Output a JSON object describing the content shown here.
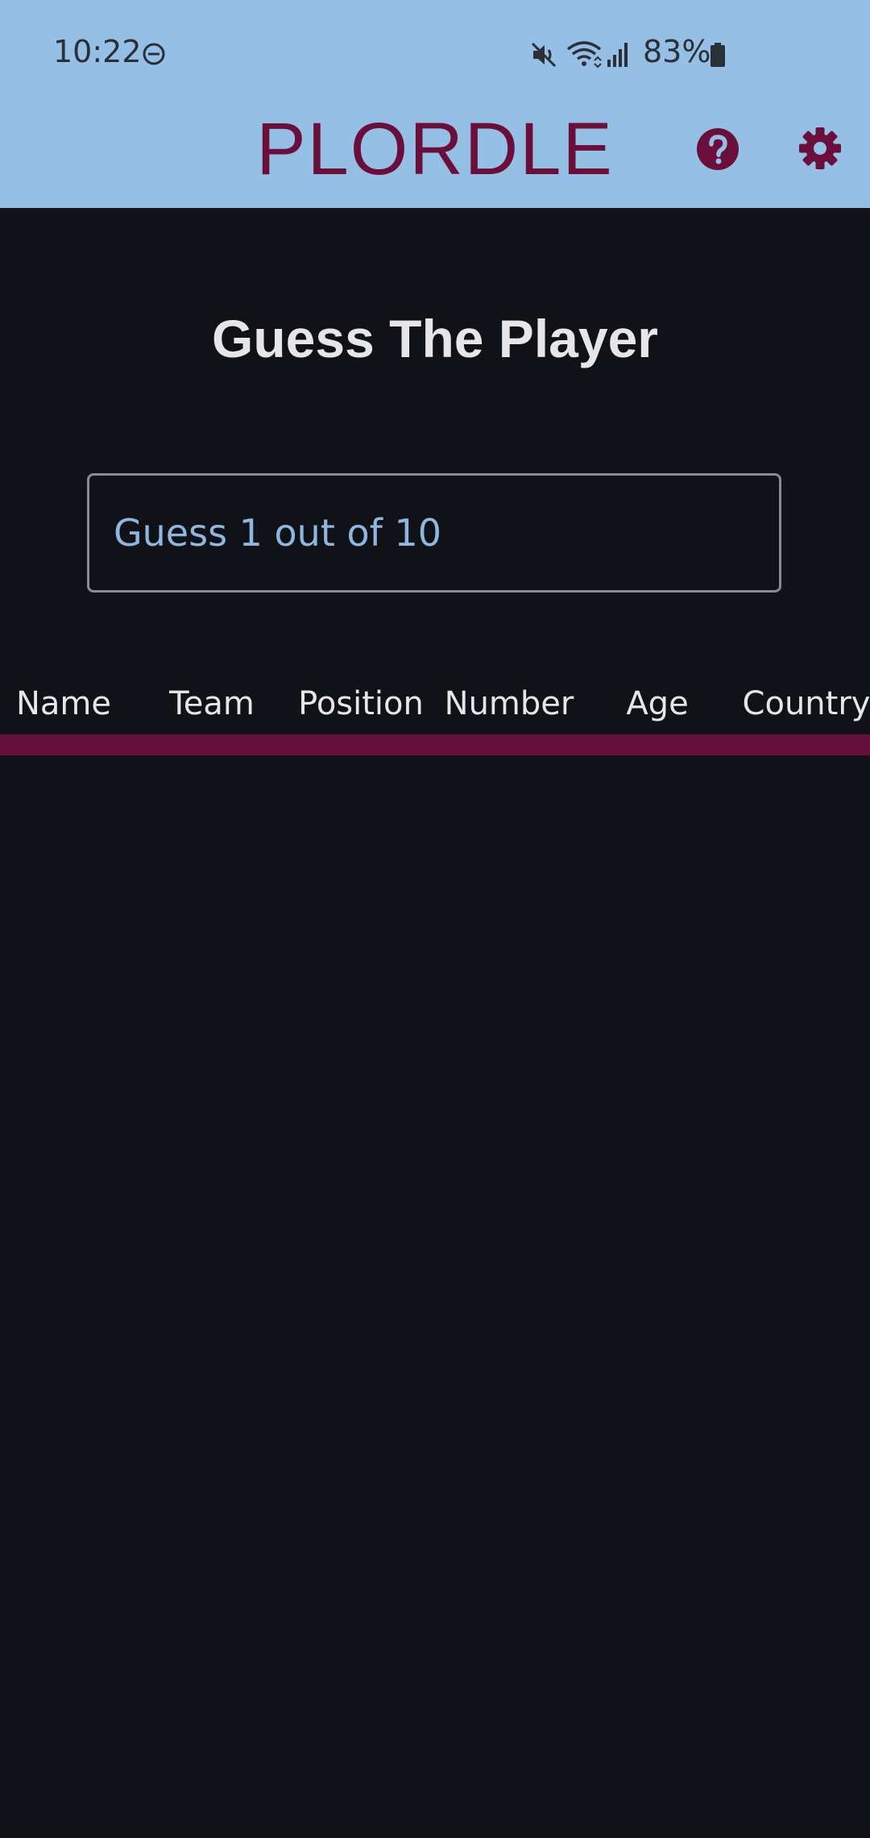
{
  "status_bar": {
    "time": "10:22",
    "battery": "83%"
  },
  "header": {
    "title": "PLORDLE"
  },
  "main": {
    "heading": "Guess The Player",
    "guess_input": {
      "placeholder": "Guess 1 out of 10",
      "value": ""
    },
    "table": {
      "columns": [
        "Name",
        "Team",
        "Position",
        "Number",
        "Age",
        "Country"
      ]
    }
  },
  "colors": {
    "header_bg": "#96bfe5",
    "brand": "#6a0f3c",
    "background": "#101217",
    "divider": "#650f3a",
    "placeholder": "#8fb6df"
  },
  "icons": {
    "help": "question-circle-icon",
    "settings": "gear-icon",
    "dnd": "do-not-disturb-icon",
    "mute": "mute-icon",
    "wifi": "wifi-icon",
    "signal": "signal-icon",
    "battery": "battery-icon"
  }
}
